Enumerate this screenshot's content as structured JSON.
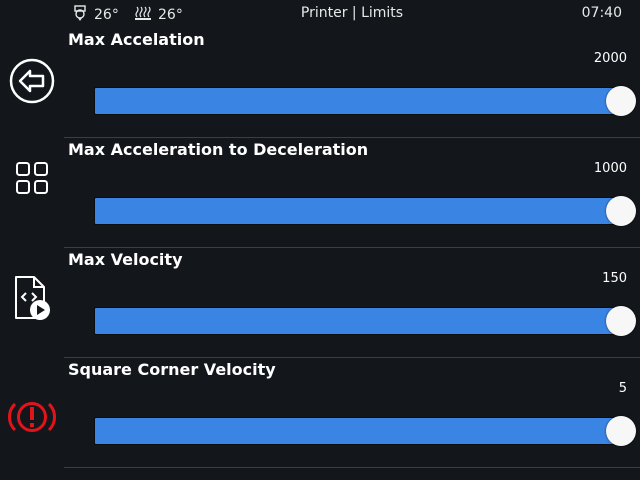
{
  "header": {
    "extruder_temp": "26°",
    "bed_temp": "26°",
    "title": "Printer | Limits",
    "time": "07:40"
  },
  "sidebar": {
    "items": [
      {
        "icon": "back-arrow-icon"
      },
      {
        "icon": "grid-menu-icon"
      },
      {
        "icon": "gcode-file-play-icon"
      },
      {
        "icon": "emergency-stop-icon",
        "color": "#e0141a"
      }
    ]
  },
  "limits": [
    {
      "label": "Max Accelation",
      "value": "2000",
      "fraction": 1.0
    },
    {
      "label": "Max Acceleration to Deceleration",
      "value": "1000",
      "fraction": 1.0
    },
    {
      "label": "Max Velocity",
      "value": "150",
      "fraction": 1.0
    },
    {
      "label": "Square Corner Velocity",
      "value": "5",
      "fraction": 1.0
    }
  ],
  "colors": {
    "background": "#13171b",
    "accent": "#3a84e3",
    "danger": "#e0141a"
  }
}
